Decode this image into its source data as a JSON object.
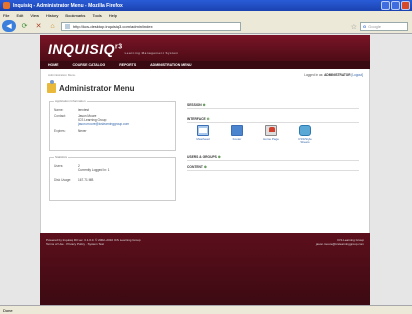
{
  "window": {
    "title": "Inquisiq - Administrator Menu - Mozilla Firefox",
    "menu": [
      "File",
      "Edit",
      "View",
      "History",
      "Bookmarks",
      "Tools",
      "Help"
    ]
  },
  "nav": {
    "url": "http://kcs-desktop.inquisiq3.com/admin/index",
    "search_placeholder": "Google"
  },
  "app": {
    "logo": "INQUISIQ",
    "logo_sup": "r3",
    "tagline": "Learning Management System",
    "main_nav": [
      "HOME",
      "COURSE CATALOG",
      "REPORTS",
      "ADMINISTRATION MENU"
    ],
    "breadcrumb": "Administration Menu",
    "logged_in_prefix": "Logged in as:",
    "logged_in_user": "ADMINISTRATOR",
    "logout": "[Logout]",
    "page_title": "Administrator Menu"
  },
  "app_info": {
    "legend": "Application Information",
    "name_label": "Name:",
    "name_value": "ienvtest",
    "contact_label": "Contact:",
    "contact_name": "Jason Moore",
    "contact_org": "ICS Learning Group",
    "contact_email": "jason.moore@icslearninggroup.com",
    "expires_label": "Expires:",
    "expires_value": "Never"
  },
  "statistics": {
    "legend": "Statistics",
    "users_label": "Users:",
    "users_count": "2",
    "users_logged": "Currently Logged In: 1",
    "disk_label": "Disk Usage:",
    "disk_value": "167.71 MB"
  },
  "sections": {
    "session": "SESSION",
    "interface": "INTERFACE",
    "users": "USERS & GROUPS",
    "content": "CONTENT"
  },
  "interface_items": [
    {
      "label": "Masthead",
      "icon": "masthead-icon"
    },
    {
      "label": "Footer",
      "icon": "footer-icon"
    },
    {
      "label": "Home Page",
      "icon": "home-page-icon"
    },
    {
      "label": "CSS/Style Sheets",
      "icon": "css-icon"
    }
  ],
  "footer": {
    "powered": "Powered by Inquisiq R3 ver. 3.1.0.0. © 2002–2010 ICS Learning Group",
    "links": "Terms of Use · Privacy Policy · System Test",
    "org": "ICS Learning Group",
    "email": "jason.moore@icslearninggroup.com"
  },
  "status": "Done"
}
